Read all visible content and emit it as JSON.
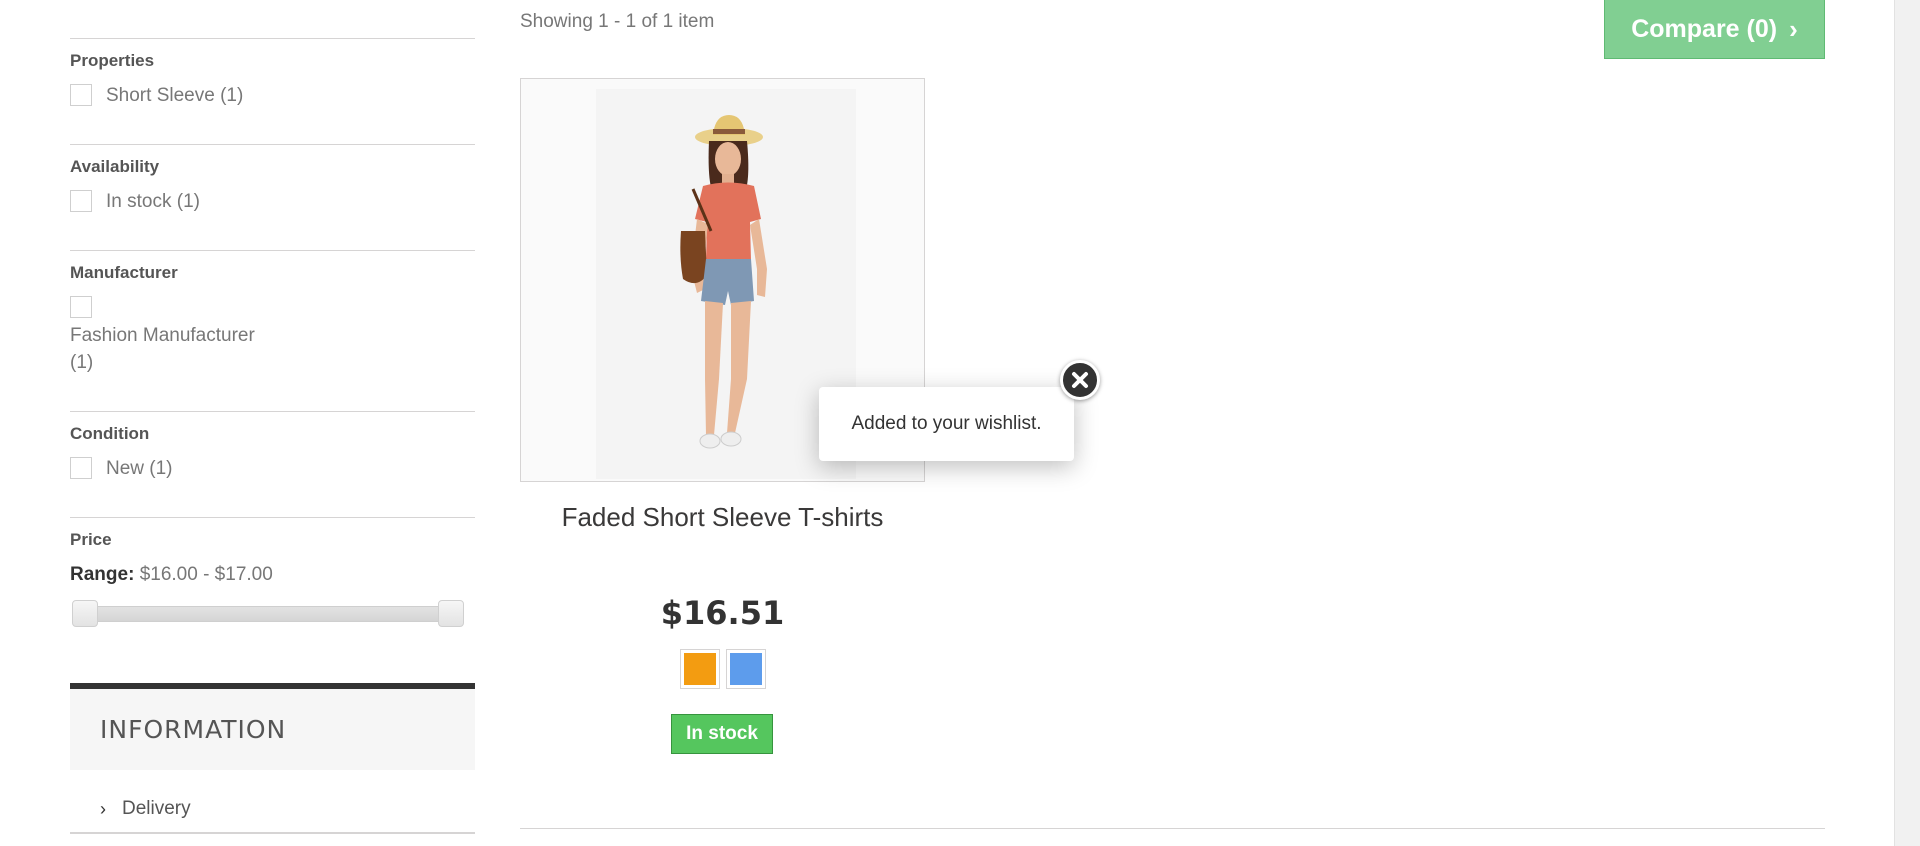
{
  "sidebar": {
    "properties": {
      "title": "Properties",
      "options": [
        {
          "label": "Short Sleeve (1)",
          "checked": false
        }
      ]
    },
    "availability": {
      "title": "Availability",
      "options": [
        {
          "label": "In stock (1)",
          "checked": false
        }
      ]
    },
    "manufacturer": {
      "title": "Manufacturer",
      "options": [
        {
          "label_line1": "Fashion Manufacturer",
          "label_line2": "(1)",
          "checked": false
        }
      ]
    },
    "condition": {
      "title": "Condition",
      "options": [
        {
          "label": "New (1)",
          "checked": false
        }
      ]
    },
    "price": {
      "title": "Price",
      "range_label": "Range:",
      "range_value": "$16.00 - $17.00",
      "min": 16.0,
      "max": 17.0
    },
    "information": {
      "title": "INFORMATION",
      "items": [
        {
          "label": "Delivery",
          "icon": "chevron-right-icon"
        }
      ]
    }
  },
  "main": {
    "showing_text": "Showing 1 - 1 of 1 item",
    "compare_button": {
      "label": "Compare (0)",
      "icon": "chevron-right-icon",
      "color": "#81cf92"
    },
    "product": {
      "name": "Faded Short Sleeve T-shirts",
      "price": "$16.51",
      "colors": [
        {
          "name": "Orange",
          "hex": "#f39c11"
        },
        {
          "name": "Blue",
          "hex": "#5d9cec"
        }
      ],
      "availability": "In stock",
      "availability_color": "#55c65e"
    }
  },
  "popup": {
    "message": "Added to your wishlist.",
    "close_icon": "close-icon"
  }
}
